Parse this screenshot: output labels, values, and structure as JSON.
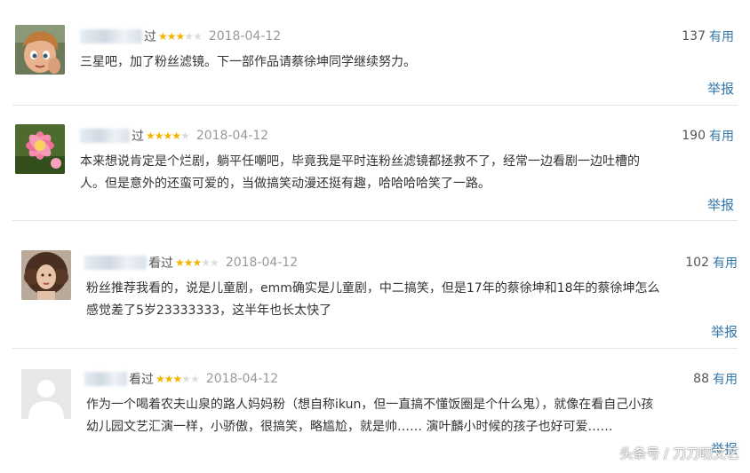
{
  "reviews": [
    {
      "seen_label": "过",
      "rating": 3,
      "date": "2018-04-12",
      "useful_count": "137",
      "useful_label": "有用",
      "content_lines": [
        "三星吧，加了粉丝滤镜。下一部作品请蔡徐坤同学继续努力。"
      ],
      "report_label": "举报",
      "avatar": "cartoon-girl-avatar"
    },
    {
      "seen_label": "过",
      "rating": 4,
      "date": "2018-04-12",
      "useful_count": "190",
      "useful_label": "有用",
      "content_lines": [
        "本来想说肯定是个烂剧，躺平任嘲吧，毕竟我是平时连粉丝滤镜都拯救不了，经常一边看剧一边吐槽的",
        "人。但是意外的还蛮可爱的，当做搞笑动漫还挺有趣，哈哈哈哈笑了一路。"
      ],
      "report_label": "举报",
      "avatar": "pink-flower-avatar"
    },
    {
      "seen_label": "看过",
      "rating": 3,
      "date": "2018-04-12",
      "useful_count": "102",
      "useful_label": "有用",
      "content_lines": [
        "粉丝推荐我看的，说是儿童剧，emm确实是儿童剧，中二搞笑，但是17年的蔡徐坤和18年的蔡徐坤怎么",
        "感觉差了5岁23333333，这半年也长太快了"
      ],
      "report_label": "举报",
      "avatar": "curly-hair-woman-avatar"
    },
    {
      "seen_label": "看过",
      "rating": 3,
      "date": "2018-04-12",
      "useful_count": "88",
      "useful_label": "有用",
      "content_lines": [
        "作为一个喝着农夫山泉的路人妈妈粉（想自称ikun，但一直搞不懂饭圈是个什么鬼），就像在看自己小孩",
        "幼儿园文艺汇演一样，小骄傲，很搞笑，略尴尬，就是帅…… 演叶麟小时候的孩子也好可爱……"
      ],
      "report_label": "举报",
      "avatar": "default-avatar"
    }
  ],
  "watermark": "头条号 / 刀刀叨文艺"
}
